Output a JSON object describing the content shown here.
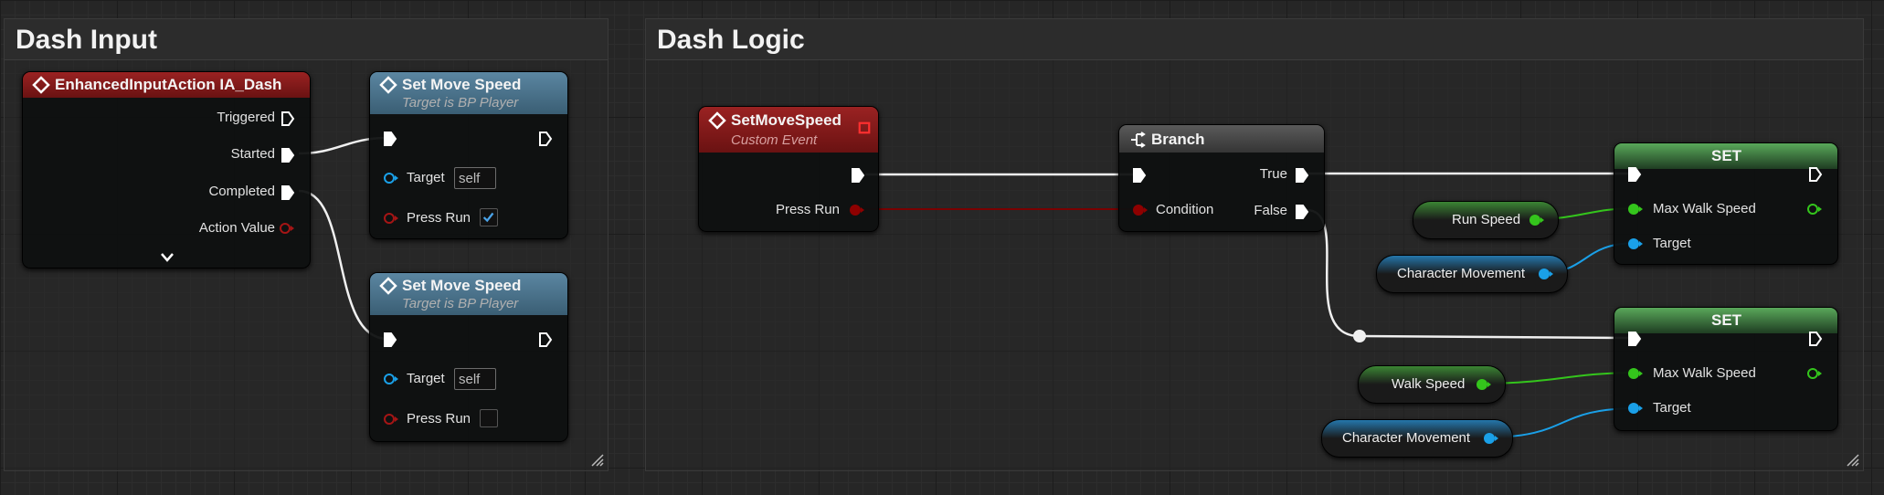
{
  "colors": {
    "exec_pin": "#ffffff",
    "bool_pin": "#8e0000",
    "float_pin": "#34c51c",
    "object_pin": "#1aa0e8",
    "event_header": "#8c1d1d",
    "function_header": "#4d7890",
    "branch_header": "#4a4a4a",
    "set_header": "#4c9b4e"
  },
  "comments": {
    "dash_input": "Dash Input",
    "dash_logic": "Dash Logic"
  },
  "input_event": {
    "title": "EnhancedInputAction IA_Dash",
    "icon": "event-diamond-icon",
    "pins": {
      "triggered": "Triggered",
      "started": "Started",
      "completed": "Completed",
      "action_value": "Action Value"
    },
    "expand_icon": "chevron-down-icon"
  },
  "set_move_speed_1": {
    "title": "Set Move Speed",
    "subtitle": "Target is BP Player",
    "target_label": "Target",
    "target_value": "self",
    "press_run_label": "Press Run",
    "press_run_checked": true
  },
  "set_move_speed_2": {
    "title": "Set Move Speed",
    "subtitle": "Target is BP Player",
    "target_label": "Target",
    "target_value": "self",
    "press_run_label": "Press Run",
    "press_run_checked": false
  },
  "custom_event": {
    "title": "SetMoveSpeed",
    "subtitle": "Custom Event",
    "press_run_label": "Press Run"
  },
  "branch": {
    "title": "Branch",
    "condition_label": "Condition",
    "true_label": "True",
    "false_label": "False"
  },
  "set_run": {
    "title": "SET",
    "max_walk_speed_label": "Max Walk Speed",
    "target_label": "Target"
  },
  "set_walk": {
    "title": "SET",
    "max_walk_speed_label": "Max Walk Speed",
    "target_label": "Target"
  },
  "variables": {
    "run_speed": "Run Speed",
    "walk_speed": "Walk Speed",
    "character_movement_1": "Character Movement",
    "character_movement_2": "Character Movement"
  }
}
